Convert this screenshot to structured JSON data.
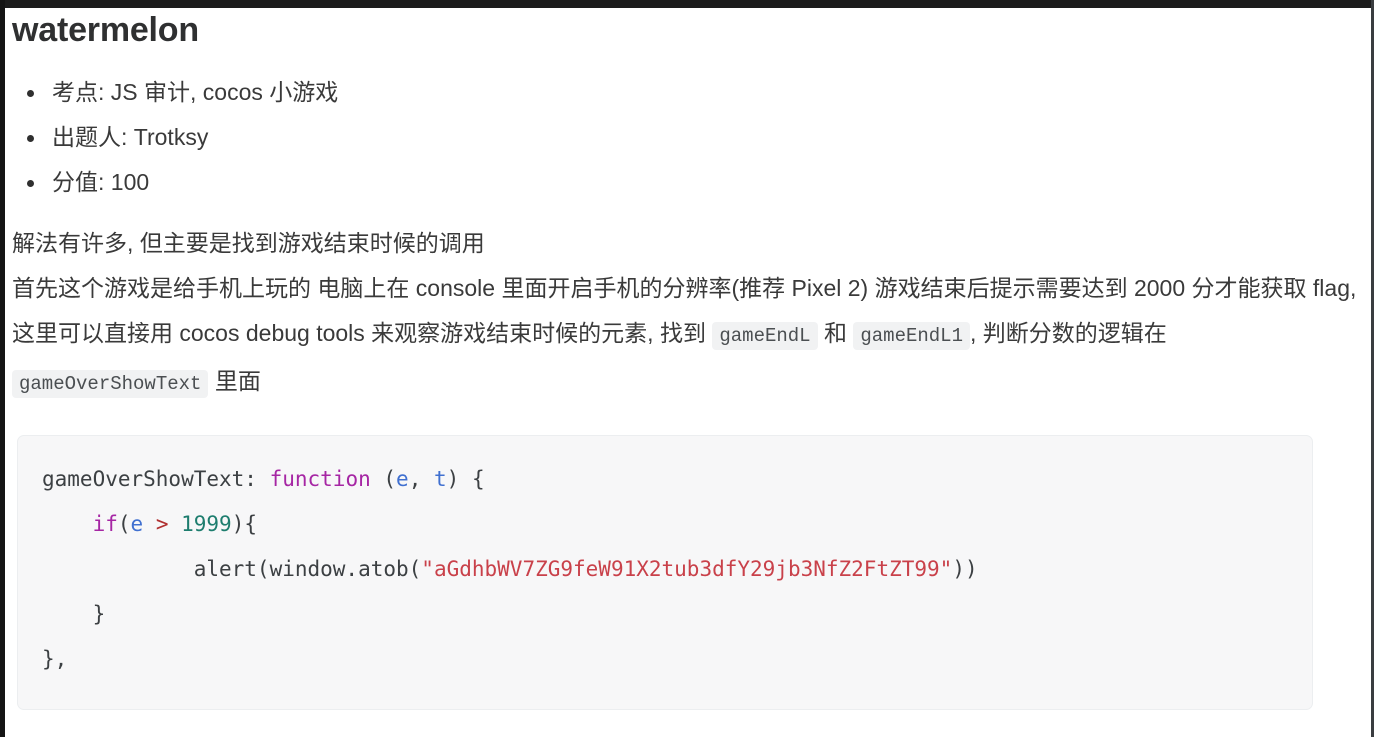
{
  "page": {
    "title": "watermelon"
  },
  "meta_list": [
    {
      "label": "考点:",
      "value": "JS 审计, cocos 小游戏",
      "text": "考点: JS 审计, cocos 小游戏"
    },
    {
      "label": "出题人:",
      "value": "Trotksy",
      "text": "出题人: Trotksy"
    },
    {
      "label": "分值:",
      "value": "100",
      "text": "分值: 100"
    }
  ],
  "paragraph": {
    "line1": "解法有许多, 但主要是找到游戏结束时候的调用",
    "line2_part1": "首先这个游戏是给手机上玩的 电脑上在 console 里面开启手机的分辨率(推荐 Pixel 2) 游戏结束后提示需要达到 2000 分才能获取 flag, 这里可以直接用 cocos debug tools 来观察游戏结束时候的元素, 找到 ",
    "code_chip_1": "gameEndL",
    "mid_text_1": " 和 ",
    "code_chip_2": "gameEndL1",
    "mid_text_2": ", 判断分数的逻辑在 ",
    "code_chip_3": "gameOverShowText",
    "tail_text": " 里面"
  },
  "code_block": {
    "language": "javascript",
    "line1_fn_name": "gameOverShowText",
    "line1_colon": ": ",
    "line1_keyword": "function",
    "line1_paren_open": " (",
    "line1_arg1": "e",
    "line1_comma": ", ",
    "line1_arg2": "t",
    "line1_paren_close": ") {",
    "line2_indent": "    ",
    "line2_keyword": "if",
    "line2_paren_open": "(",
    "line2_var": "e",
    "line2_operator": " > ",
    "line2_number": "1999",
    "line2_tail": "){",
    "line3_indent": "            ",
    "line3_call": "alert(window.atob(",
    "line3_string": "\"aGdhbWV7ZG9feW91X2tub3dfY29jb3NfZ2FtZT99\"",
    "line3_tail": "))",
    "line4": "    }",
    "line5": "},",
    "full_text": "gameOverShowText: function (e, t) {\n    if(e > 1999){\n            alert(window.atob(\"aGdhbWV7ZG9feW91X2tub3dfY29jb3NfZ2FtZT99\"))\n    }\n},"
  },
  "colors": {
    "page_background": "#ffffff",
    "title": "#2f3031",
    "body_text": "#3a3a3a",
    "code_block_bg": "#f7f7f8",
    "code_block_border": "#eceef0",
    "inline_code_bg": "#f1f2f3",
    "syntax_keyword": "#a626a4",
    "syntax_variable": "#4070d0",
    "syntax_number": "#1d7d6e",
    "syntax_operator": "#b03030",
    "syntax_string": "#c9414a",
    "chrome_dark": "#1c1c1c"
  }
}
